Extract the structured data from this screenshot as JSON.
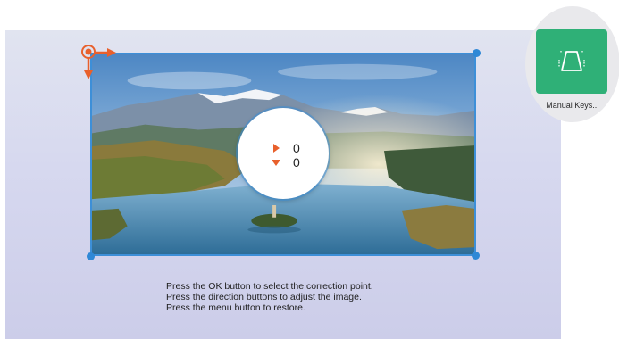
{
  "readout": {
    "horizontal_value": "0",
    "vertical_value": "0",
    "horizontal_icon": "triangle-right-icon",
    "vertical_icon": "triangle-down-icon"
  },
  "instructions": {
    "line1": "Press the OK button to select the correction point.",
    "line2": "Press the direction buttons to adjust the image.",
    "line3": "Press the menu button to restore."
  },
  "app": {
    "label": "Manual Keys...",
    "icon": "keystone-trapezoid-icon"
  },
  "colors": {
    "frame": "#3d8fd8",
    "accent": "#e8602c",
    "tile": "#2fb077"
  }
}
